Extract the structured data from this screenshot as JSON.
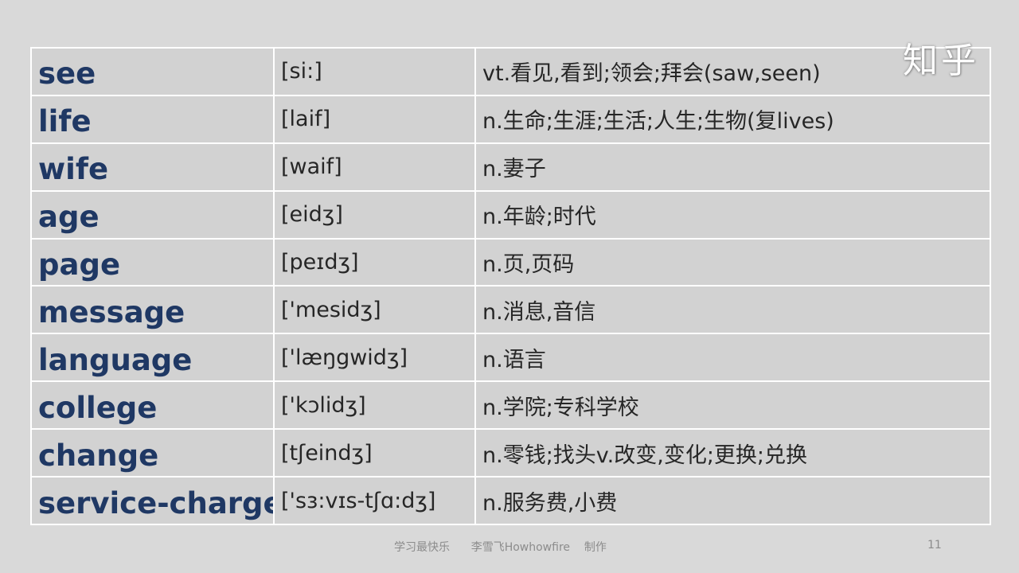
{
  "watermark": "知乎",
  "vocabulary": [
    {
      "word": "see",
      "phonetic": "[si:]",
      "meaning": "vt.看见,看到;领会;拜会(saw,seen)"
    },
    {
      "word": "life",
      "phonetic": "[laif]",
      "meaning": "n.生命;生涯;生活;人生;生物(复lives)"
    },
    {
      "word": "wife",
      "phonetic": "[waif]",
      "meaning": "n.妻子"
    },
    {
      "word": "age",
      "phonetic": "[eidʒ]",
      "meaning": "n.年龄;时代"
    },
    {
      "word": "page",
      "phonetic": "[peɪdʒ]",
      "meaning": "n.页,页码"
    },
    {
      "word": "message",
      "phonetic": "['mesidʒ]",
      "meaning": "n.消息,音信"
    },
    {
      "word": "language",
      "phonetic": "['læŋgwidʒ]",
      "meaning": "n.语言"
    },
    {
      "word": "college",
      "phonetic": "['kɔlidʒ]",
      "meaning": "n.学院;专科学校"
    },
    {
      "word": "change",
      "phonetic": "[tʃeindʒ]",
      "meaning": "n.零钱;找头v.改变,变化;更换;兑换"
    },
    {
      "word": "service-charge",
      "phonetic": "['sɜ:vɪs-tʃɑ:dʒ]",
      "meaning": "n.服务费,小费"
    }
  ],
  "footer": {
    "text": "学习最快乐      李雪飞Howhowfire    制作",
    "page_number": "11"
  },
  "colors": {
    "background": "#d9d9d9",
    "cell_background": "#d2d2d2",
    "grid_lines": "#ffffff",
    "word_text": "#1f3864",
    "body_text": "#262626",
    "footer_text": "#8c8c8c"
  }
}
